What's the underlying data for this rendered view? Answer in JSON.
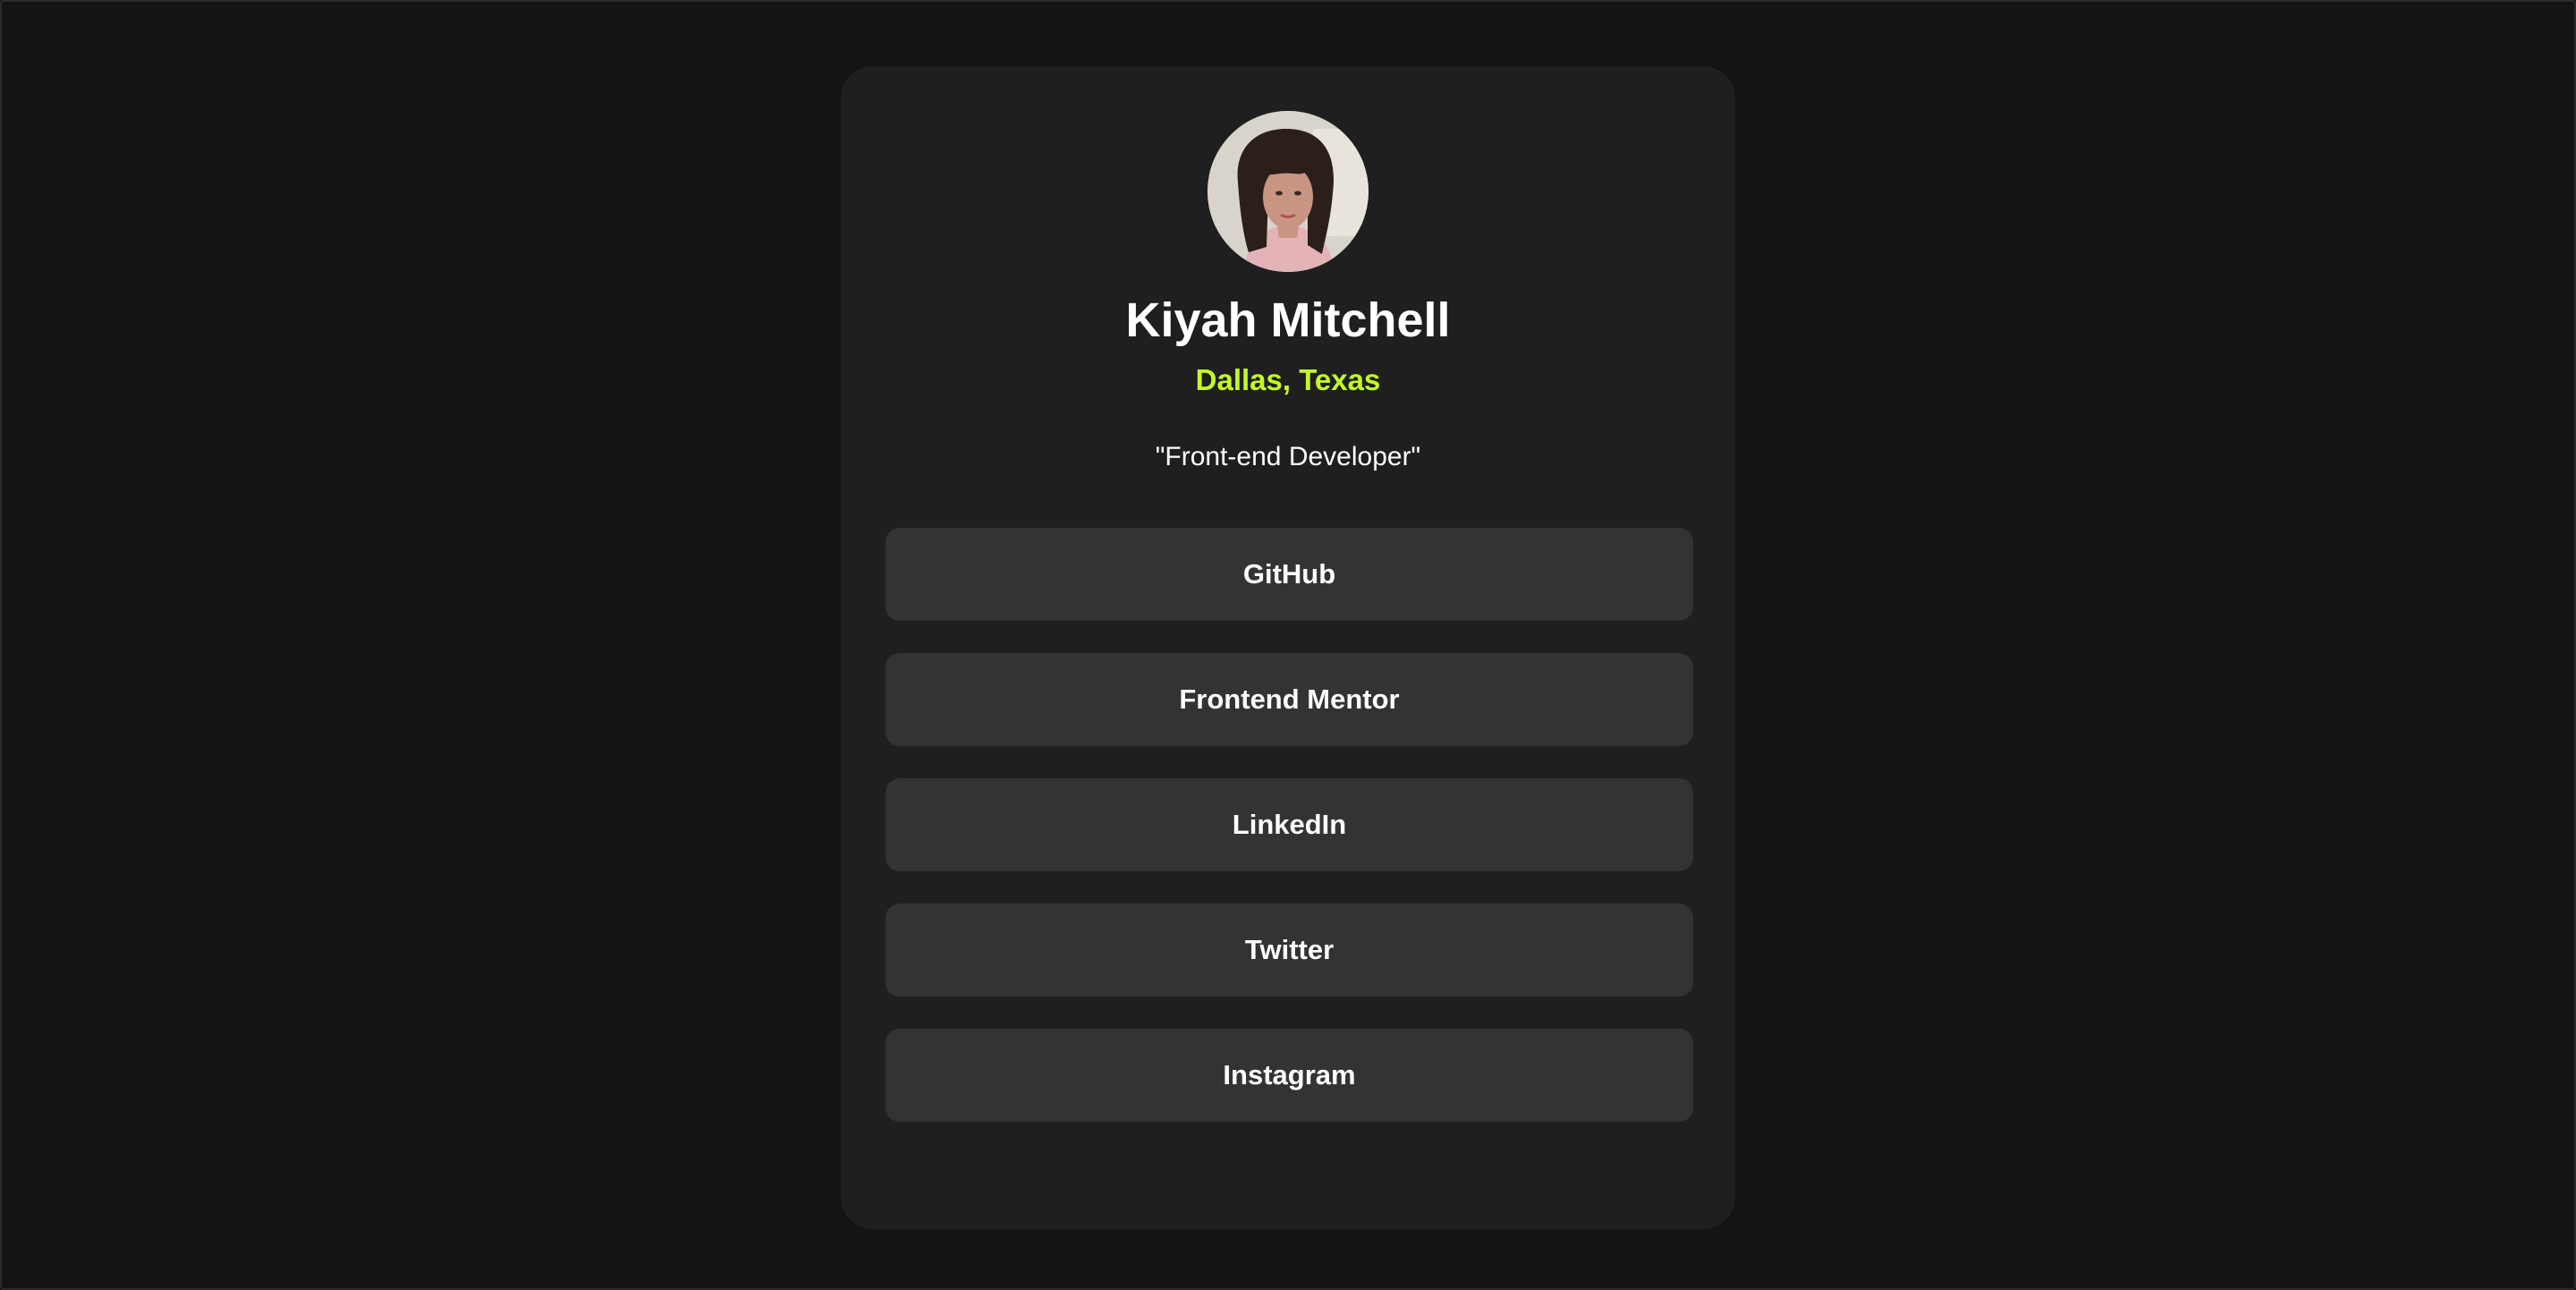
{
  "profile": {
    "name": "Kiyah Mitchell",
    "location": "Dallas, Texas",
    "bio": "\"Front-end Developer\""
  },
  "links": [
    {
      "label": "GitHub"
    },
    {
      "label": "Frontend Mentor"
    },
    {
      "label": "LinkedIn"
    },
    {
      "label": "Twitter"
    },
    {
      "label": "Instagram"
    }
  ],
  "colors": {
    "background": "#141414",
    "card": "#1f1f1f",
    "button": "#333333",
    "accent": "#c4f82a",
    "text": "#ffffff"
  }
}
